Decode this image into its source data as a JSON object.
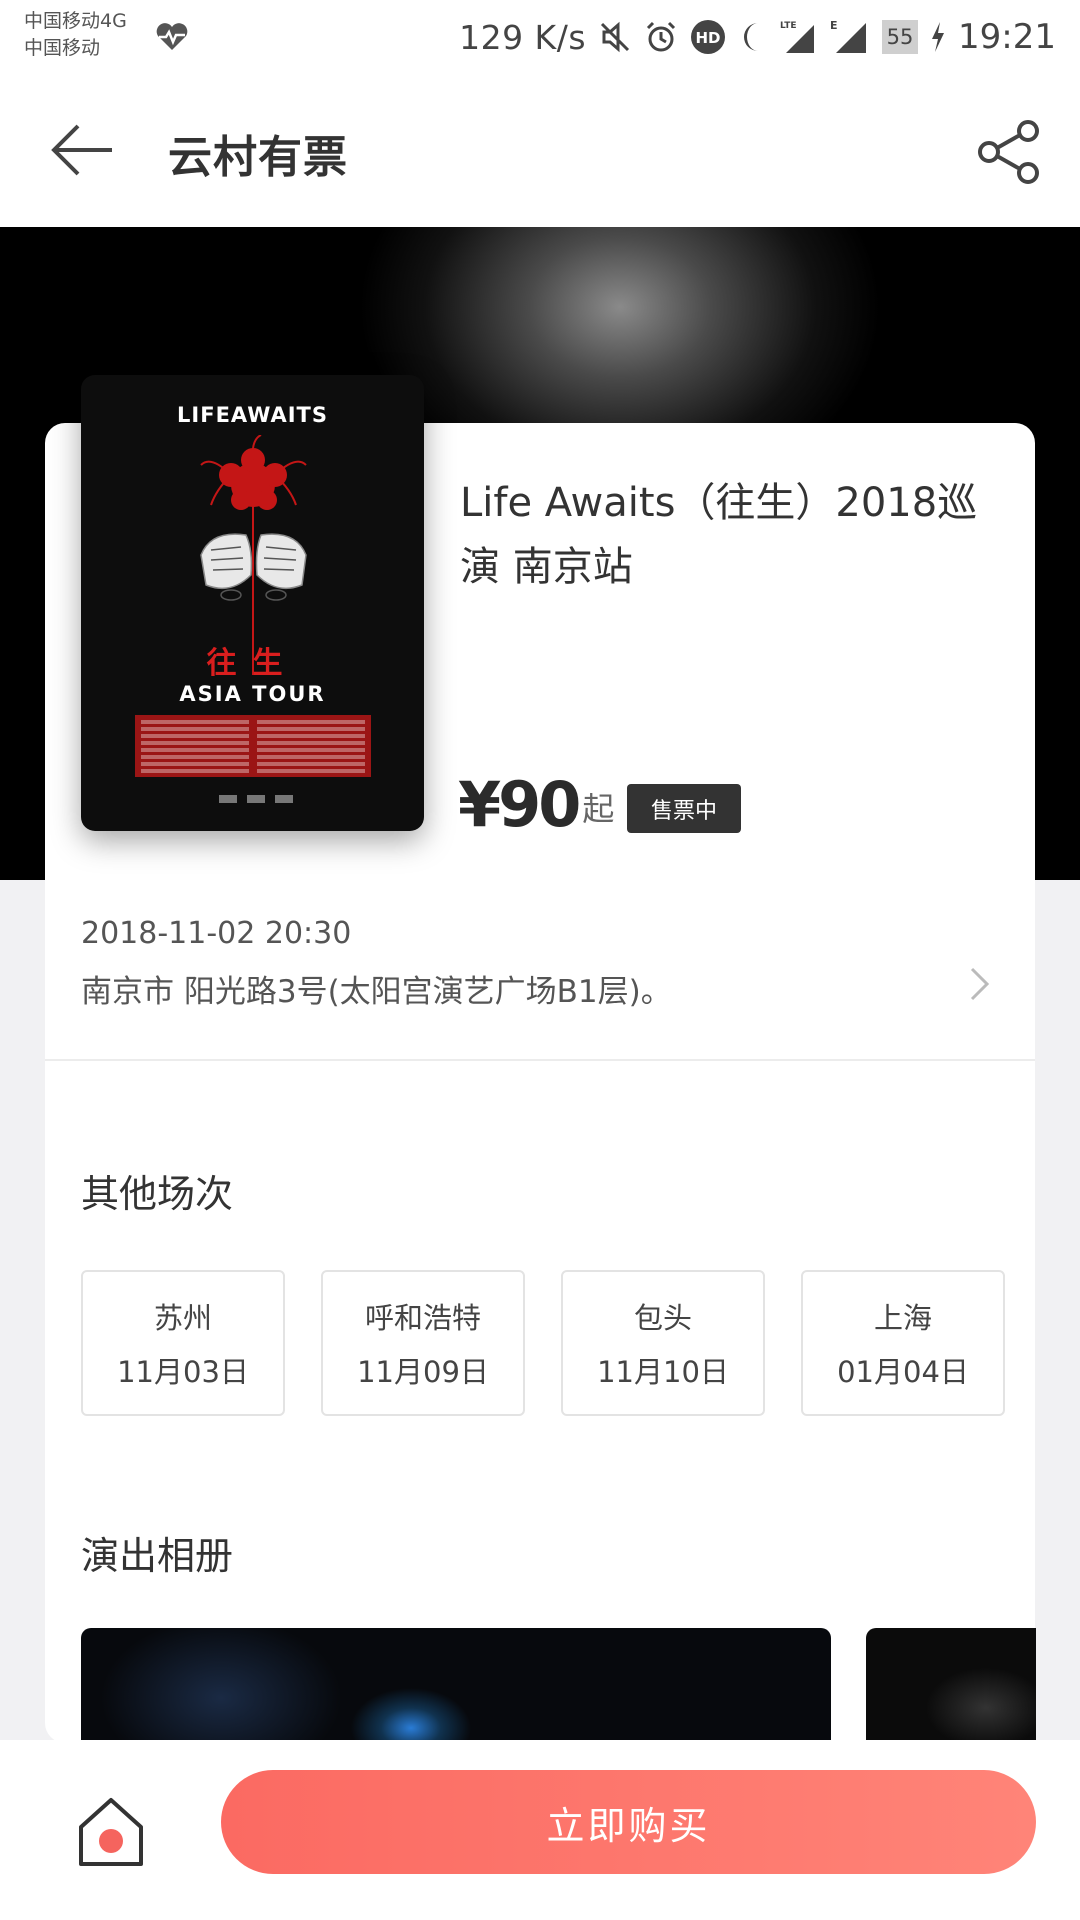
{
  "status_bar": {
    "carrier_line1": "中国移动4G",
    "carrier_line2": "中国移动",
    "speed": "129 K/s",
    "battery": "55",
    "time": "19:21",
    "icons": [
      "heart-pulse-icon",
      "mute-icon",
      "alarm-icon",
      "hd-icon",
      "moon-icon",
      "lte-signal-icon",
      "e-signal-icon",
      "battery-icon",
      "charging-icon"
    ]
  },
  "header": {
    "title": "云村有票",
    "back_icon": "back-arrow-icon",
    "share_icon": "share-icon"
  },
  "event": {
    "poster": {
      "title": "LIFEAWAITS",
      "cn_title": "往生",
      "subtitle": "ASIA TOUR"
    },
    "title": "Life Awaits（往生）2018巡演 南京站",
    "price": "¥90",
    "price_suffix": "起",
    "status": "售票中",
    "datetime": "2018-11-02 20:30",
    "address": "南京市 阳光路3号(太阳宫演艺广场B1层)。"
  },
  "other_sessions": {
    "title": "其他场次",
    "items": [
      {
        "city": "苏州",
        "date": "11月03日"
      },
      {
        "city": "呼和浩特",
        "date": "11月09日"
      },
      {
        "city": "包头",
        "date": "11月10日"
      },
      {
        "city": "上海",
        "date": "01月04日"
      }
    ]
  },
  "album": {
    "title": "演出相册"
  },
  "bottom_bar": {
    "buy_label": "立即购买"
  },
  "colors": {
    "accent": "#fb6a62",
    "badge_bg": "#333333"
  }
}
